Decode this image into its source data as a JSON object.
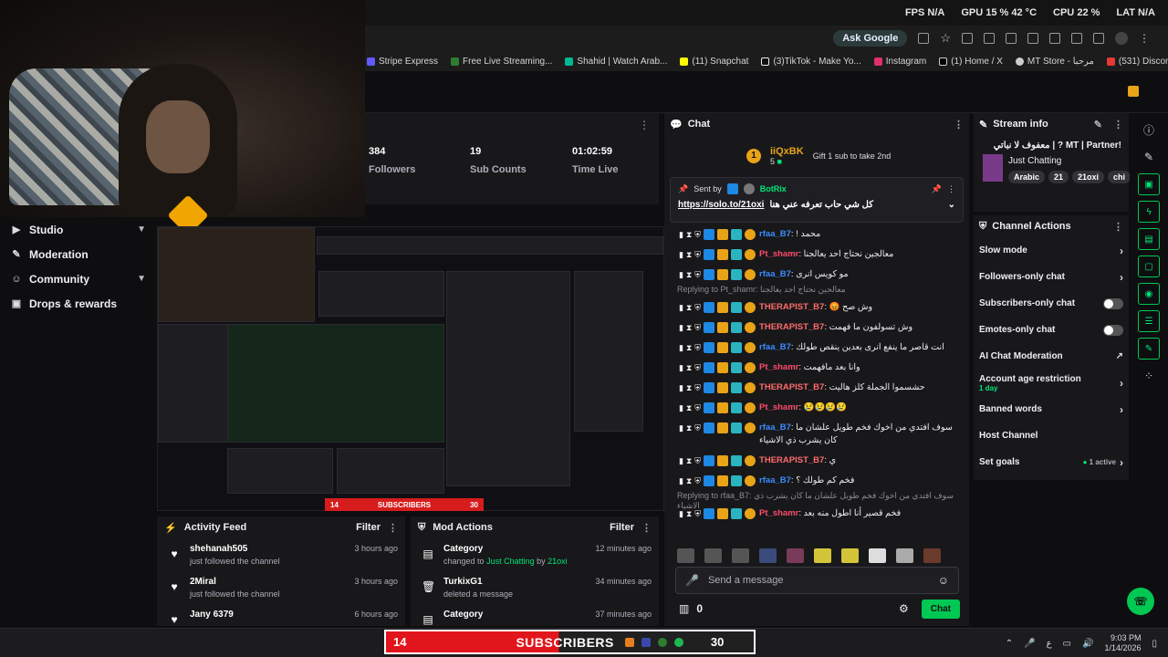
{
  "hud": {
    "fps_label": "FPS",
    "fps_value": "N/A",
    "gpu_label": "GPU",
    "gpu_value": "15 % 42 °C",
    "cpu_label": "CPU",
    "cpu_value": "22 %",
    "lat_label": "LAT",
    "lat_value": "N/A"
  },
  "browser": {
    "ask_google": "Ask Google",
    "bookmarks": [
      "Stripe Express",
      "Free Live Streaming...",
      "Shahid | Watch Arab...",
      "(11) Snapchat",
      "(3)TikTok - Make Yo...",
      "Instagram",
      "(1) Home / X",
      "MT Store - مرحبا",
      "(531) Discord | Frien..."
    ]
  },
  "leftnav": [
    {
      "label": "Studio",
      "icon": "video-icon",
      "chevron": true
    },
    {
      "label": "Moderation",
      "icon": "wrench-icon",
      "chevron": false
    },
    {
      "label": "Community",
      "icon": "people-icon",
      "chevron": true
    },
    {
      "label": "Drops & rewards",
      "icon": "gift-icon",
      "chevron": false
    }
  ],
  "stats": [
    {
      "value": "384",
      "label": "Followers"
    },
    {
      "value": "19",
      "label": "Sub Counts"
    },
    {
      "value": "01:02:59",
      "label": "Time Live"
    }
  ],
  "activity": {
    "title": "Activity Feed",
    "filter": "Filter",
    "items": [
      {
        "user": "shehanah505",
        "desc": "just followed the channel",
        "time": "3 hours ago"
      },
      {
        "user": "2Miral",
        "desc": "just followed the channel",
        "time": "3 hours ago"
      },
      {
        "user": "Jany 6379",
        "desc": "",
        "time": "6 hours ago"
      }
    ]
  },
  "modactions": {
    "title": "Mod Actions",
    "filter": "Filter",
    "items": [
      {
        "title": "Category",
        "desc_prefix": "changed to",
        "highlight": "Just Chatting",
        "by": "by",
        "actor": "21oxi",
        "time": "12 minutes ago"
      },
      {
        "title": "TurkixG1",
        "desc_prefix": "deleted a message",
        "highlight": "",
        "by": "",
        "actor": "",
        "time": "34 minutes ago"
      },
      {
        "title": "Category",
        "desc_prefix": "",
        "highlight": "",
        "by": "",
        "actor": "",
        "time": "37 minutes ago"
      }
    ]
  },
  "chat": {
    "title": "Chat",
    "gift_user": "iiQxBK",
    "gift_count": "5",
    "gift_cta": "Gift 1 sub to take 2nd",
    "pinned_sent_by": "Sent by",
    "pinned_bot": "BotRix",
    "pinned_text": "كل شي حاب تعرفه عني هنا",
    "pinned_link": "https://solo.to/21oxi",
    "messages": [
      {
        "user": "rfaa_B7",
        "color": "#3b8cff",
        "text": "! محمد",
        "reply": ""
      },
      {
        "user": "Pt_shamr",
        "color": "#ff4b6b",
        "text": "معالجين نحتاج احد يعالجنا",
        "reply": ""
      },
      {
        "user": "rfaa_B7",
        "color": "#3b8cff",
        "text": "مو كويس انرى",
        "reply": ""
      },
      {
        "user": "THERAPIST_B7",
        "color": "#ff6b6b",
        "text": "😡 وش صح",
        "reply": "Replying to Pt_shamr: معالجين نحتاج احد يعالجنا"
      },
      {
        "user": "THERAPIST_B7",
        "color": "#ff6b6b",
        "text": "وش تسولفون ما فهمت",
        "reply": ""
      },
      {
        "user": "rfaa_B7",
        "color": "#3b8cff",
        "text": "انت قاصر ما ينفع انرى بعدين ينقص طولك",
        "reply": ""
      },
      {
        "user": "Pt_shamr",
        "color": "#ff4b6b",
        "text": "وانا بعد مافهمت",
        "reply": ""
      },
      {
        "user": "THERAPIST_B7",
        "color": "#ff6b6b",
        "text": "حشسموا الجملة كلز هاليت",
        "reply": ""
      },
      {
        "user": "Pt_shamr",
        "color": "#ff4b6b",
        "text": "😢😢😢😢",
        "reply": ""
      },
      {
        "user": "rfaa_B7",
        "color": "#3b8cff",
        "text": "سوف افتدي من اخوك فخم طويل علشان ما كان يشرب ذي الاشياء",
        "reply": ""
      },
      {
        "user": "THERAPIST_B7",
        "color": "#ff6b6b",
        "text": "ي",
        "reply": ""
      },
      {
        "user": "rfaa_B7",
        "color": "#3b8cff",
        "text": "فخم كم طولك ؟",
        "reply": ""
      },
      {
        "user": "Pt_shamr",
        "color": "#ff4b6b",
        "text": "فخم قصير أنا اطول منه بعد",
        "reply": "Replying to rfaa_B7: سوف افتدي من اخوك فخم طويل علشان ما كان يشرب ذي الاشياء"
      }
    ],
    "input_placeholder": "Send a message",
    "points": "0",
    "send_label": "Chat"
  },
  "streaminfo": {
    "title": "Stream info",
    "stream_title": "!MT | Partner ? | معفوف لا نباتي",
    "category": "Just Chatting",
    "tags": [
      "Arabic",
      "21",
      "21oxi",
      "chi"
    ]
  },
  "chanactions": {
    "title": "Channel Actions",
    "items": [
      {
        "label": "Slow mode",
        "kind": "arrow",
        "sub": ""
      },
      {
        "label": "Followers-only chat",
        "kind": "arrow",
        "sub": ""
      },
      {
        "label": "Subscribers-only chat",
        "kind": "toggle",
        "sub": ""
      },
      {
        "label": "Emotes-only chat",
        "kind": "toggle",
        "sub": ""
      },
      {
        "label": "AI Chat Moderation",
        "kind": "ext",
        "sub": ""
      },
      {
        "label": "Account age restriction",
        "kind": "arrow",
        "sub": "1 day"
      },
      {
        "label": "Banned words",
        "kind": "arrow",
        "sub": ""
      },
      {
        "label": "Host Channel",
        "kind": "none",
        "sub": ""
      },
      {
        "label": "Set goals",
        "kind": "arrow",
        "sub": "1 active"
      }
    ]
  },
  "subbar": {
    "left": "14",
    "label": "SUBSCRIBERS",
    "right": "30"
  },
  "preview_subbar": {
    "left": "14",
    "label": "SUBSCRIBERS",
    "right": "30"
  },
  "clock": {
    "time": "9:03 PM",
    "date": "1/14/2026"
  },
  "tray_lang": "ع",
  "colors": {
    "accent": "#00c853",
    "kick_green": "#00e676",
    "subbar_red": "#e0161c"
  }
}
